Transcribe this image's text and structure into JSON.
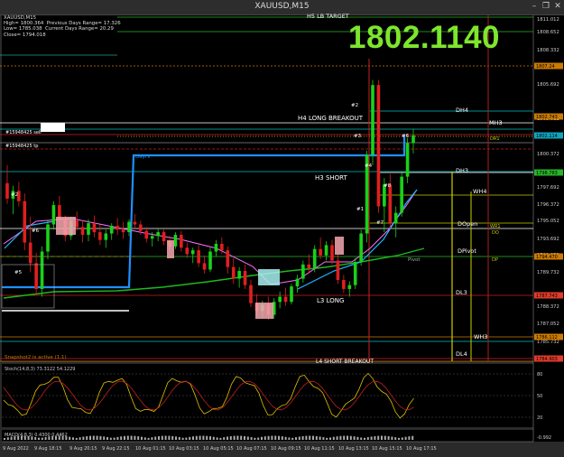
{
  "window": {
    "title": "XAUUSD,M15",
    "buttons": {
      "minimize": "–",
      "restore": "❐",
      "close": "✕"
    }
  },
  "price_display": "1802.1140",
  "info": {
    "symbol": "XAUUSD,M15",
    "high": "High= 1800.364",
    "prev_range": "Previous Days Range= 17.326",
    "low": "Low= 1785.038",
    "cur_range": "Current Days Range= 20.29",
    "close": "Close= 1794.018"
  },
  "colors": {
    "background": "#000000",
    "bull": "#19d219",
    "bear": "#e01f1f",
    "big_price": "#7ee62d",
    "macd": "#e0c000",
    "signal": "#c02020"
  },
  "chart_data": {
    "type": "candlestick",
    "y_axis_ticks": [
      "1811.012",
      "1808.652",
      "1808.332",
      "1805.692",
      "1803.012",
      "1802.692",
      "1800.372",
      "1797.692",
      "1796.372",
      "1795.052",
      "1793.692",
      "1791.052",
      "1789.732",
      "1788.372",
      "1787.052",
      "1785.732"
    ],
    "price_tags": [
      {
        "text": "1802.114",
        "y": 1802.114,
        "color": "#0ea5c0"
      },
      {
        "text": "1802.743",
        "y": 1802.743,
        "color": "#cc7a00"
      },
      {
        "text": "1807.24",
        "y": 1807.24,
        "color": "#cc7a00"
      },
      {
        "text": "1798.783",
        "y": 1798.783,
        "color": "#28b428"
      },
      {
        "text": "1794.470",
        "y": 1794.47,
        "color": "#cc7a00"
      },
      {
        "text": "1787.743",
        "y": 1787.743,
        "color": "#e03b2b"
      },
      {
        "text": "1786.112",
        "y": 1786.112,
        "color": "#cc7a00"
      },
      {
        "text": "1784.903",
        "y": 1784.903,
        "color": "#e03b2b"
      }
    ],
    "x_axis_labels": [
      "9 Aug 2022",
      "9 Aug 18:15",
      "9 Aug 20:15",
      "9 Aug 22:15",
      "10 Aug 01:15",
      "10 Aug 03:15",
      "10 Aug 05:15",
      "10 Aug 07:15",
      "10 Aug 09:15",
      "10 Aug 11:15",
      "10 Aug 13:15",
      "10 Aug 15:15",
      "10 Aug 17:15"
    ],
    "ylim": [
      1784.6,
      1811.4
    ],
    "candles": [
      [
        1798.4,
        1799.8,
        1796.8,
        1797.2
      ],
      [
        1797.2,
        1798.2,
        1796.0,
        1797.8
      ],
      [
        1797.8,
        1798.5,
        1796.6,
        1797.0
      ],
      [
        1797.0,
        1797.6,
        1793.2,
        1793.8
      ],
      [
        1793.8,
        1795.8,
        1791.5,
        1792.2
      ],
      [
        1792.2,
        1793.0,
        1789.8,
        1790.2
      ],
      [
        1790.2,
        1793.5,
        1789.6,
        1793.1
      ],
      [
        1793.1,
        1795.5,
        1792.5,
        1795.2
      ],
      [
        1795.2,
        1797.0,
        1794.8,
        1796.7
      ],
      [
        1796.7,
        1797.4,
        1795.1,
        1795.6
      ],
      [
        1795.6,
        1795.9,
        1793.9,
        1794.3
      ],
      [
        1794.3,
        1795.8,
        1794.0,
        1795.5
      ],
      [
        1795.5,
        1796.2,
        1794.7,
        1795.0
      ],
      [
        1795.0,
        1795.5,
        1793.8,
        1794.4
      ],
      [
        1794.4,
        1795.6,
        1793.9,
        1795.3
      ],
      [
        1795.3,
        1795.9,
        1794.2,
        1794.6
      ],
      [
        1794.6,
        1795.2,
        1793.6,
        1794.0
      ],
      [
        1794.0,
        1794.8,
        1793.4,
        1794.5
      ],
      [
        1794.5,
        1795.3,
        1794.0,
        1795.1
      ],
      [
        1795.1,
        1795.7,
        1794.4,
        1794.8
      ],
      [
        1794.8,
        1795.4,
        1794.1,
        1794.6
      ],
      [
        1794.6,
        1795.6,
        1794.3,
        1795.4
      ],
      [
        1795.4,
        1796.0,
        1794.8,
        1795.2
      ],
      [
        1795.2,
        1795.5,
        1794.4,
        1794.7
      ],
      [
        1794.7,
        1795.0,
        1793.8,
        1794.1
      ],
      [
        1794.1,
        1794.6,
        1793.5,
        1794.3
      ],
      [
        1794.3,
        1794.9,
        1793.9,
        1794.6
      ],
      [
        1794.6,
        1794.8,
        1793.6,
        1793.9
      ],
      [
        1793.9,
        1794.3,
        1793.2,
        1793.5
      ],
      [
        1793.5,
        1794.6,
        1793.3,
        1794.4
      ],
      [
        1794.4,
        1794.7,
        1793.1,
        1793.4
      ],
      [
        1793.4,
        1793.8,
        1792.6,
        1792.9
      ],
      [
        1792.9,
        1793.4,
        1792.2,
        1793.2
      ],
      [
        1793.2,
        1793.6,
        1791.9,
        1792.2
      ],
      [
        1792.2,
        1792.8,
        1791.4,
        1791.7
      ],
      [
        1791.7,
        1793.4,
        1791.5,
        1793.1
      ],
      [
        1793.1,
        1794.0,
        1792.7,
        1793.7
      ],
      [
        1793.7,
        1794.2,
        1792.9,
        1793.2
      ],
      [
        1793.2,
        1793.5,
        1791.4,
        1791.9
      ],
      [
        1791.9,
        1792.6,
        1790.6,
        1791.0
      ],
      [
        1791.0,
        1791.9,
        1790.3,
        1791.6
      ],
      [
        1791.6,
        1792.1,
        1790.2,
        1790.5
      ],
      [
        1790.5,
        1790.9,
        1788.8,
        1789.1
      ],
      [
        1789.1,
        1789.8,
        1788.1,
        1788.5
      ],
      [
        1788.5,
        1789.3,
        1787.9,
        1789.0
      ],
      [
        1789.0,
        1789.6,
        1787.8,
        1788.2
      ],
      [
        1788.2,
        1789.5,
        1787.9,
        1789.2
      ],
      [
        1789.2,
        1790.0,
        1788.7,
        1789.6
      ],
      [
        1789.6,
        1790.3,
        1788.9,
        1789.2
      ],
      [
        1789.2,
        1790.6,
        1789.0,
        1790.4
      ],
      [
        1790.4,
        1791.3,
        1789.9,
        1791.0
      ],
      [
        1791.0,
        1792.4,
        1790.7,
        1792.1
      ],
      [
        1792.1,
        1792.9,
        1791.4,
        1791.8
      ],
      [
        1791.8,
        1793.6,
        1791.5,
        1793.3
      ],
      [
        1793.3,
        1794.2,
        1792.5,
        1792.8
      ],
      [
        1792.8,
        1793.9,
        1792.4,
        1793.6
      ],
      [
        1793.6,
        1794.0,
        1792.1,
        1792.4
      ],
      [
        1792.4,
        1792.9,
        1790.6,
        1790.9
      ],
      [
        1790.9,
        1791.3,
        1789.9,
        1790.2
      ],
      [
        1790.2,
        1790.8,
        1789.6,
        1790.5
      ],
      [
        1790.5,
        1792.6,
        1790.2,
        1792.3
      ],
      [
        1792.3,
        1794.8,
        1792.0,
        1794.5
      ],
      [
        1794.5,
        1800.9,
        1793.8,
        1800.6
      ],
      [
        1800.6,
        1806.4,
        1799.8,
        1806.0
      ],
      [
        1806.0,
        1806.4,
        1796.1,
        1796.6
      ],
      [
        1796.6,
        1798.8,
        1794.6,
        1798.3
      ],
      [
        1798.3,
        1799.1,
        1794.9,
        1795.3
      ],
      [
        1795.3,
        1796.6,
        1794.2,
        1796.1
      ],
      [
        1796.1,
        1799.2,
        1795.8,
        1798.9
      ],
      [
        1798.9,
        1801.9,
        1798.4,
        1801.5
      ],
      [
        1801.5,
        1802.6,
        1800.7,
        1802.1
      ]
    ],
    "levels": [
      {
        "label": "H4 LONG BREAKOUT",
        "y": 1803.3,
        "color": "#ffffff"
      },
      {
        "label": "H3 SHORT",
        "y": 1798.9,
        "color": "#ffffff"
      },
      {
        "label": "L3 LONG",
        "y": 1789.7,
        "color": "#ff3030"
      },
      {
        "label": "DH4",
        "y": 1803.8,
        "color": "#00d0d0"
      },
      {
        "label": "DH3",
        "y": 1798.9,
        "color": "#00d0d0"
      },
      {
        "label": "WH4",
        "y": 1797.2,
        "color": "#00d0d0"
      },
      {
        "label": "MH3",
        "y": 1802.7,
        "color": "#00d0d0"
      },
      {
        "label": "DOpen",
        "y": 1795.0,
        "color": "#cccc00"
      },
      {
        "label": "DPivot",
        "y": 1793.3,
        "color": "#cccc00"
      },
      {
        "label": "DL3",
        "y": 1789.7,
        "color": "#cccc00"
      },
      {
        "label": "WH3",
        "y": 1786.0,
        "color": "#00d0d0"
      },
      {
        "label": "DL4",
        "y": 1785.2,
        "color": "#cccc00"
      },
      {
        "label": "DR1",
        "y": 1802.0,
        "color": "#cccc00"
      },
      {
        "label": "WR1",
        "y": 1794.8,
        "color": "#cccc00"
      },
      {
        "label": "DO",
        "y": 1794.5,
        "color": "#cccc00"
      },
      {
        "label": "DP",
        "y": 1793.3,
        "color": "#cccc00"
      },
      {
        "label": "Pivot",
        "y": 1792.8,
        "color": "#aaaaaa"
      },
      {
        "label": "DayHi",
        "y": 1800.3,
        "color": "#1e90ff"
      }
    ],
    "annotations": [
      "#2",
      "#3",
      "#4",
      "#6",
      "#1",
      "#7",
      "#8",
      "#2",
      "#5",
      "#6",
      "#15948425 sell",
      "#15948425 tp",
      "H5 LB TARGET",
      "L4 SHORT BREAKOUT",
      "Snapshot2 is active (1.1)"
    ],
    "stoch_label": "Stoch(14,8,3) 73.3122 54.1229",
    "stoch_levels": [
      "80",
      "50",
      "20"
    ],
    "macd_label": "MACD(4,8,3) 0.4300 0.4462",
    "macd_levels": [
      "-0.992"
    ]
  }
}
